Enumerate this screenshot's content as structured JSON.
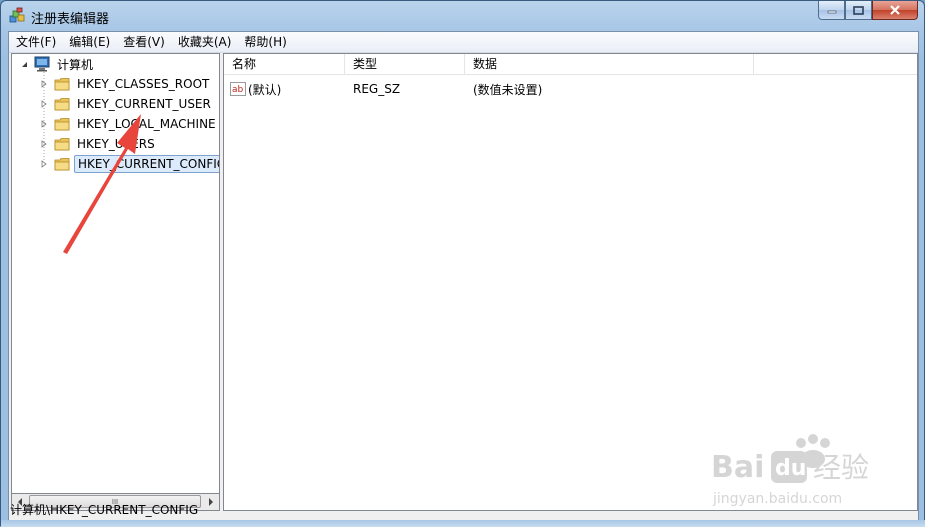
{
  "window": {
    "title": "注册表编辑器"
  },
  "menu": {
    "items": [
      "文件(F)",
      "编辑(E)",
      "查看(V)",
      "收藏夹(A)",
      "帮助(H)"
    ]
  },
  "tree": {
    "root_label": "计算机",
    "items": [
      {
        "label": "HKEY_CLASSES_ROOT"
      },
      {
        "label": "HKEY_CURRENT_USER"
      },
      {
        "label": "HKEY_LOCAL_MACHINE"
      },
      {
        "label": "HKEY_USERS"
      },
      {
        "label": "HKEY_CURRENT_CONFIG",
        "selected": true
      }
    ]
  },
  "list": {
    "columns": [
      "名称",
      "类型",
      "数据"
    ],
    "rows": [
      {
        "name": "(默认)",
        "type": "REG_SZ",
        "data": "(数值未设置)",
        "icon": "string-value-icon"
      }
    ]
  },
  "scrollbar": {
    "thumb_grip": "III"
  },
  "statusbar": {
    "path": "计算机\\HKEY_CURRENT_CONFIG"
  },
  "watermark": {
    "brand": "Bai du 经验",
    "url": "jingyan.baidu.com"
  },
  "colors": {
    "annotation_arrow": "#e8453c",
    "selection_bg": "#dcebfc",
    "selection_border": "#7da2ce",
    "folder_yellow": "#f5d57a"
  }
}
